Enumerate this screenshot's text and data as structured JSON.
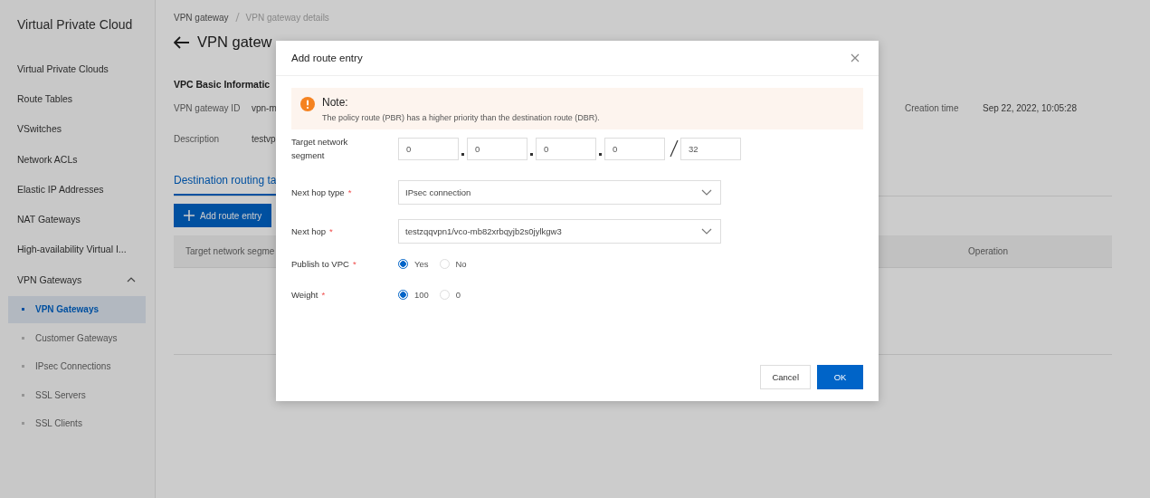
{
  "sidebar": {
    "title": "Virtual Private Cloud",
    "items": [
      {
        "label": "Virtual Private Clouds",
        "selected": false
      },
      {
        "label": "Route Tables",
        "selected": false
      },
      {
        "label": "VSwitches",
        "selected": false
      },
      {
        "label": "Network ACLs",
        "selected": false
      },
      {
        "label": "Elastic IP Addresses",
        "selected": false
      },
      {
        "label": "NAT Gateways",
        "selected": false
      },
      {
        "label": "High-availability Virtual I...",
        "selected": false
      },
      {
        "label": "VPN Gateways",
        "selected": false,
        "expanded": true,
        "children": [
          {
            "label": "VPN Gateways",
            "selected": true
          },
          {
            "label": "Customer Gateways",
            "selected": false
          },
          {
            "label": "IPsec Connections",
            "selected": false
          },
          {
            "label": "SSL Servers",
            "selected": false
          },
          {
            "label": "SSL Clients",
            "selected": false
          }
        ]
      }
    ]
  },
  "breadcrumb": [
    "VPN gateway",
    "VPN gateway details"
  ],
  "page_title": "VPN gatew",
  "section_title": "VPC Basic Informatic",
  "info_rows": [
    {
      "fields": [
        {
          "label": "VPN gateway ID",
          "value": "vpn-m"
        },
        {
          "label": "Creation time",
          "value": "Sep 22, 2022, 10:05:28"
        }
      ]
    },
    {
      "fields": [
        {
          "label": "Description",
          "value": "testvp"
        }
      ]
    }
  ],
  "tabs": [
    {
      "label": "Destination routing ta",
      "selected": true
    }
  ],
  "add_button": "Add route entry",
  "table": {
    "columns": [
      "Target network segme",
      "Operation"
    ]
  },
  "dialog": {
    "title": "Add route entry",
    "note": {
      "title": "Note:",
      "text": "The policy route (PBR) has a higher priority than the destination route (DBR)."
    },
    "fields": [
      {
        "kind": "segment",
        "label": "Target network segment",
        "octets": [
          "0",
          "0",
          "0",
          "0"
        ],
        "mask": "32"
      },
      {
        "kind": "select",
        "label": "Next hop type",
        "required_mark": "*",
        "value": "IPsec connection"
      },
      {
        "kind": "select",
        "label": "Next hop",
        "required_mark": "*",
        "value": "testzqqvpn1/vco-mb82xrbqyjb2s0jylkgw3"
      },
      {
        "kind": "radio",
        "label": "Publish to VPC",
        "required_mark": "*",
        "options": [
          {
            "label": "Yes",
            "selected": true
          },
          {
            "label": "No",
            "selected": false
          }
        ]
      },
      {
        "kind": "radio",
        "label": "Weight",
        "required_mark": "*",
        "options": [
          {
            "label": "100",
            "selected": true
          },
          {
            "label": "0",
            "selected": false
          }
        ]
      }
    ],
    "buttons": [
      {
        "label": "Cancel",
        "primary": false
      },
      {
        "label": "OK",
        "primary": true
      }
    ]
  }
}
